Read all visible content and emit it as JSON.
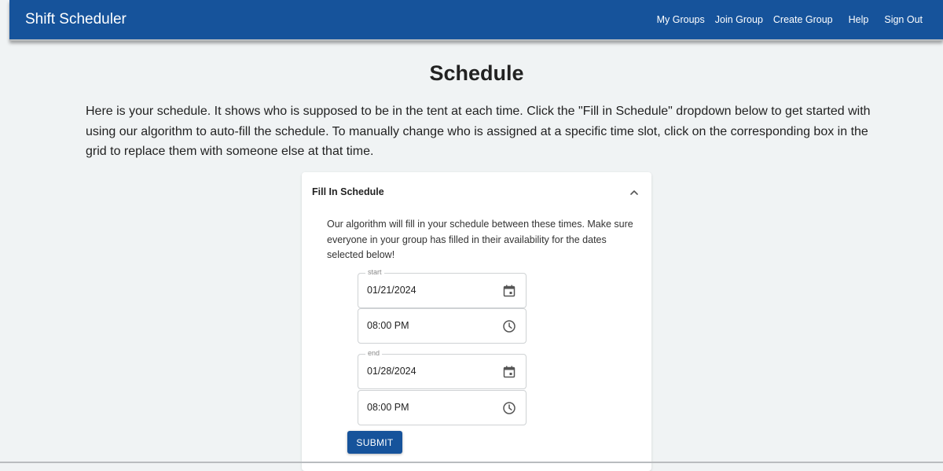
{
  "app": {
    "title": "Shift Scheduler",
    "nav": [
      "My Groups",
      "Join Group",
      "Create Group",
      "Help",
      "Sign Out"
    ]
  },
  "page": {
    "title": "Schedule",
    "intro": "Here is your schedule. It shows who is supposed to be in the tent at each time. Click the \"Fill in Schedule\" dropdown below to get started with using our algorithm to auto-fill the schedule. To manually change who is assigned at a specific time slot, click on the corresponding box in the grid to replace them with someone else at that time."
  },
  "fill_panel": {
    "title": "Fill In Schedule",
    "expanded": true,
    "expand_icon": "chevron-up-icon",
    "description": "Our algorithm will fill in your schedule between these times. Make sure everyone in your group has filled in their availability for the dates selected below!",
    "start": {
      "label": "start",
      "date": "01/21/2024",
      "time": "08:00 PM",
      "date_icon": "calendar-icon",
      "time_icon": "clock-icon"
    },
    "end": {
      "label": "end",
      "date": "01/28/2024",
      "time": "08:00 PM",
      "date_icon": "calendar-icon",
      "time_icon": "clock-icon"
    },
    "submit_label": "SUBMIT"
  },
  "colors": {
    "primary": "#16539b",
    "background": "#f0f3f4"
  }
}
